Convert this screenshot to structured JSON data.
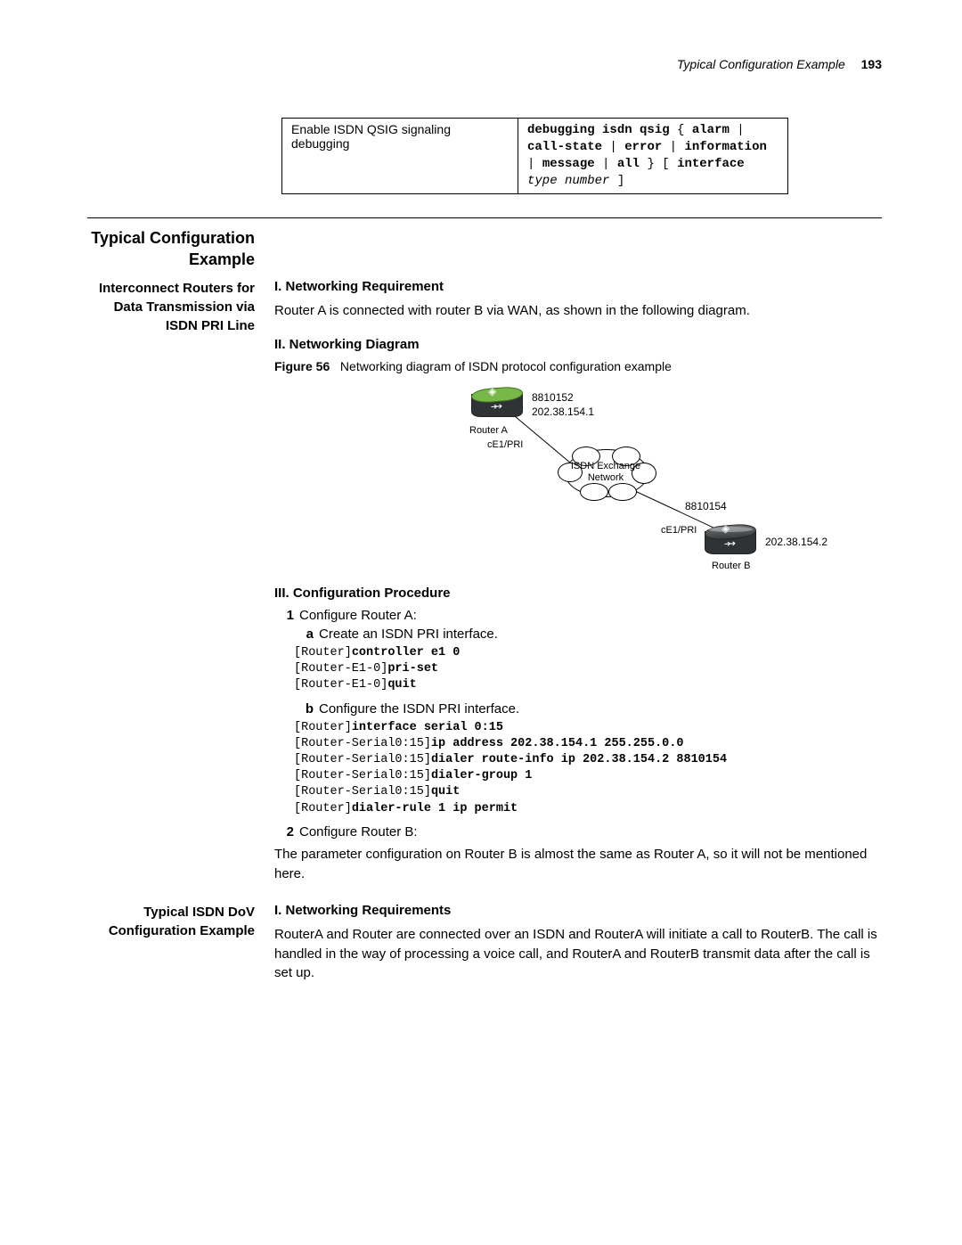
{
  "header": {
    "title": "Typical Configuration Example",
    "page": "193"
  },
  "table": {
    "desc": "Enable ISDN QSIG signaling debugging",
    "cmd_plain": "debugging isdn qsig { alarm | call-state | error | information | message | all } [ interface",
    "cmd_italic1": "type number",
    "cmd_tail": " ]"
  },
  "s_main_title": "Typical Configuration Example",
  "sec1": {
    "side": "Interconnect Routers for Data Transmission via ISDN PRI Line",
    "h_req": "I. Networking Requirement",
    "req_body": "Router A is connected with router B via WAN, as shown in the following diagram.",
    "h_diag": "II. Networking Diagram",
    "fig_label": "Figure 56",
    "fig_caption": "Networking diagram of ISDN protocol configuration example",
    "diagram": {
      "routerA_name": "Router A",
      "routerA_iface": "cE1/PRI",
      "routerA_num": "8810152",
      "routerA_ip": "202.38.154.1",
      "cloud": "ISDN Exchange Network",
      "routerB_name": "Router B",
      "routerB_iface": "cE1/PRI",
      "routerB_num": "8810154",
      "routerB_ip": "202.38.154.2"
    },
    "h_proc": "III. Configuration Procedure",
    "step1_label": "1",
    "step1_text": "Configure Router A:",
    "step1a_label": "a",
    "step1a_text": "Create an ISDN PRI interface.",
    "code1_p1": "[Router]",
    "code1_b1": "controller e1 0",
    "code1_p2": "[Router-E1-0]",
    "code1_b2": "pri-set",
    "code1_p3": "[Router-E1-0]",
    "code1_b3": "quit",
    "step1b_label": "b",
    "step1b_text": "Configure the ISDN PRI interface.",
    "code2_p1": "[Router]",
    "code2_b1": "interface serial 0:15",
    "code2_p2": "[Router-Serial0:15]",
    "code2_b2": "ip address 202.38.154.1 255.255.0.0",
    "code2_p3": "[Router-Serial0:15]",
    "code2_b3": "dialer route-info ip 202.38.154.2 8810154",
    "code2_p4": "[Router-Serial0:15]",
    "code2_b4": "dialer-group 1",
    "code2_p5": "[Router-Serial0:15]",
    "code2_b5": "quit",
    "code2_p6": "[Router]",
    "code2_b6": "dialer-rule 1 ip permit",
    "step2_label": "2",
    "step2_text": "Configure Router B:",
    "step2_body": "The parameter configuration on Router B is almost the same as Router A, so it will not be mentioned here."
  },
  "sec2": {
    "side": "Typical ISDN DoV Configuration Example",
    "h_req": "I. Networking Requirements",
    "req_body": "RouterA and Router are connected over an ISDN and RouterA will initiate a call to RouterB. The call is handled in the way of processing a voice call, and RouterA and RouterB transmit data after the call is set up."
  }
}
